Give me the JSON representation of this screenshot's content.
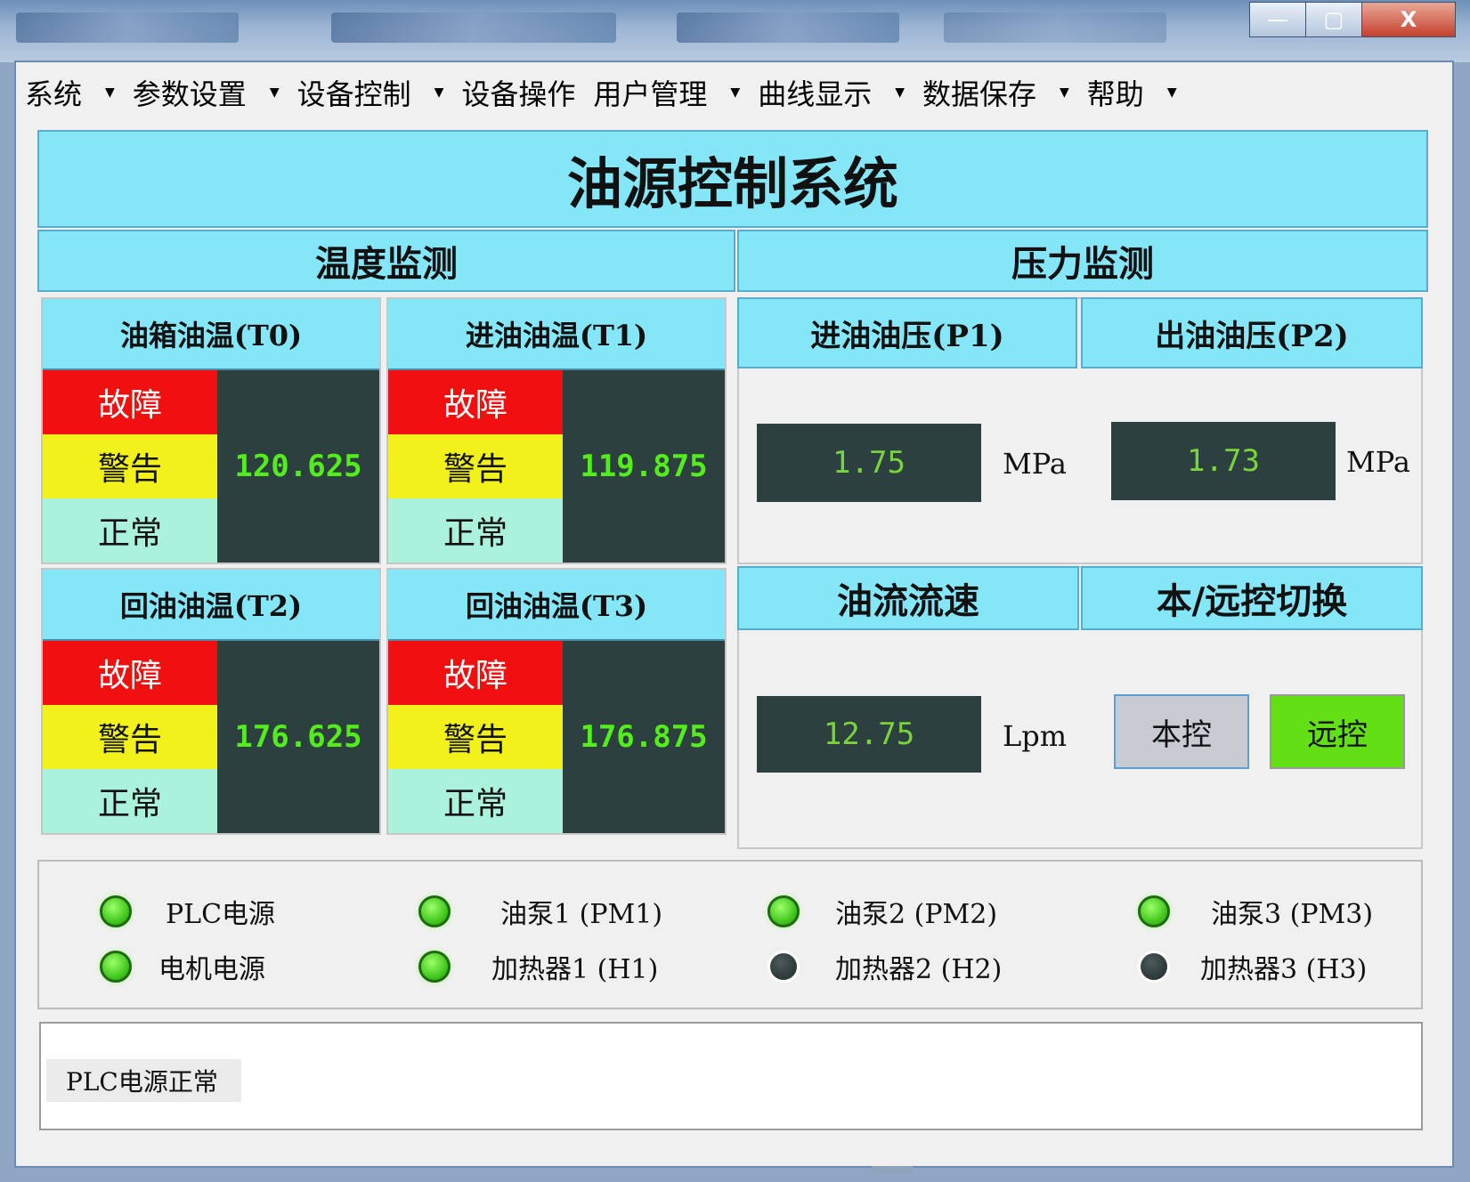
{
  "window": {
    "controls": [
      "—",
      "▢",
      "X"
    ]
  },
  "menu": [
    {
      "label": "系统",
      "arrow": true
    },
    {
      "label": "参数设置",
      "arrow": true
    },
    {
      "label": "设备控制",
      "arrow": true
    },
    {
      "label": "设备操作",
      "arrow": false
    },
    {
      "label": "用户管理",
      "arrow": true
    },
    {
      "label": "曲线显示",
      "arrow": true
    },
    {
      "label": "数据保存",
      "arrow": true
    },
    {
      "label": "帮助",
      "arrow": true
    }
  ],
  "title": "油源控制系统",
  "temperature": {
    "heading": "温度监测",
    "status_labels": {
      "fault": "故障",
      "warn": "警告",
      "normal": "正常"
    },
    "cards": [
      {
        "label": "油箱油温(T0)",
        "value": "120.625"
      },
      {
        "label": "进油油温(T1)",
        "value": "119.875"
      },
      {
        "label": "回油油温(T2)",
        "value": "176.625"
      },
      {
        "label": "回油油温(T3)",
        "value": "176.875"
      }
    ]
  },
  "pressure": {
    "heading": "压力监测",
    "p1": {
      "label": "进油油压(P1)",
      "value": "1.75",
      "unit": "MPa"
    },
    "p2": {
      "label": "出油油压(P2)",
      "value": "1.73",
      "unit": "MPa"
    }
  },
  "flow": {
    "label": "油流流速",
    "value": "12.75",
    "unit": "Lpm"
  },
  "control_mode": {
    "label": "本/远控切换",
    "local": "本控",
    "remote": "远控",
    "active": "remote"
  },
  "indicators": [
    {
      "label": "PLC电源",
      "on": true
    },
    {
      "label": "油泵1 (PM1)",
      "on": true
    },
    {
      "label": "油泵2 (PM2)",
      "on": true
    },
    {
      "label": "油泵3 (PM3)",
      "on": true
    },
    {
      "label": "电机电源",
      "on": true
    },
    {
      "label": "加热器1 (H1)",
      "on": true
    },
    {
      "label": "加热器2 (H2)",
      "on": false
    },
    {
      "label": "加热器3 (H3)",
      "on": false
    }
  ],
  "log": {
    "messages": [
      "PLC电源正常"
    ]
  },
  "colors": {
    "header_cyan": "#85e6f8",
    "fault": "#f01010",
    "warn": "#f2f21a",
    "normal": "#aaf2dc",
    "display_bg": "#2c4040",
    "display_text": "#54ec1c",
    "remote_green": "#62e015"
  }
}
